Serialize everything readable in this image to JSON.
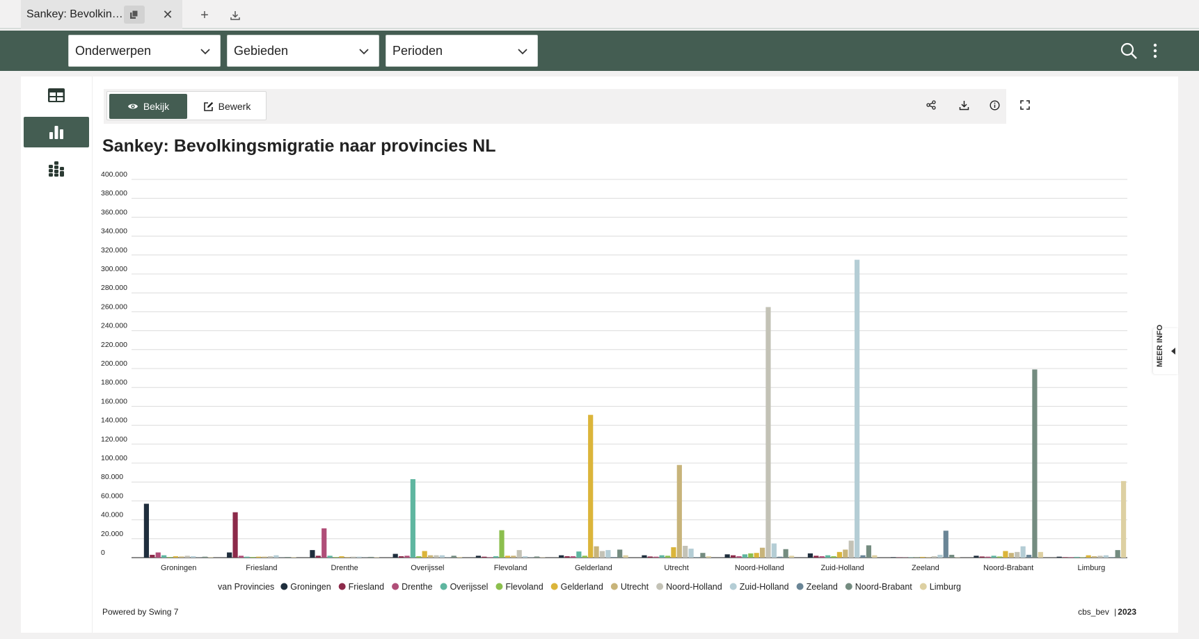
{
  "tab": {
    "title": "Sankey: Bevolkingsmigratie naar provincies NL",
    "close": "✕",
    "new": "+"
  },
  "filters": [
    {
      "label": "Onderwerpen"
    },
    {
      "label": "Gebieden"
    },
    {
      "label": "Perioden"
    }
  ],
  "view": {
    "bekijk": "Bekijk",
    "bewerk": "Bewerk"
  },
  "meer_info": "MEER INFO",
  "footer": {
    "powered": "Powered by Swing 7",
    "source": "cbs_bev",
    "year": "2023"
  },
  "chart_data": {
    "type": "bar",
    "title": "Sankey: Bevolkingsmigratie naar provincies NL",
    "xlabel": "",
    "ylabel": "",
    "ylim": [
      0,
      400000
    ],
    "yticks": [
      0,
      20000,
      40000,
      60000,
      80000,
      100000,
      120000,
      140000,
      160000,
      180000,
      200000,
      220000,
      240000,
      260000,
      280000,
      300000,
      320000,
      340000,
      360000,
      380000,
      400000
    ],
    "ytick_labels": [
      "0",
      "20.000",
      "40.000",
      "60.000",
      "80.000",
      "100.000",
      "120.000",
      "140.000",
      "160.000",
      "180.000",
      "200.000",
      "220.000",
      "240.000",
      "260.000",
      "280.000",
      "300.000",
      "320.000",
      "340.000",
      "360.000",
      "380.000",
      "400.000"
    ],
    "grid": true,
    "legend_title": "van Provincies",
    "legend_position": "bottom",
    "categories": [
      "Groningen",
      "Friesland",
      "Drenthe",
      "Overijssel",
      "Flevoland",
      "Gelderland",
      "Utrecht",
      "Noord-Holland",
      "Zuid-Holland",
      "Zeeland",
      "Noord-Brabant",
      "Limburg"
    ],
    "series": [
      {
        "name": "Groningen",
        "color": "#1f2e3d",
        "values": [
          57000,
          5500,
          8000,
          4000,
          2000,
          2500,
          2500,
          3500,
          4500,
          500,
          2000,
          1000
        ]
      },
      {
        "name": "Friesland",
        "color": "#8c2a4a",
        "values": [
          3000,
          48000,
          2000,
          1500,
          1000,
          1500,
          1200,
          2500,
          2000,
          300,
          1200,
          500
        ]
      },
      {
        "name": "Drenthe",
        "color": "#b04e78",
        "values": [
          5500,
          2000,
          31000,
          2000,
          500,
          1500,
          1000,
          1500,
          1500,
          200,
          1000,
          500
        ]
      },
      {
        "name": "Overijssel",
        "color": "#5fb6a0",
        "values": [
          2500,
          1000,
          2000,
          83000,
          1500,
          6500,
          2500,
          3500,
          2500,
          300,
          2000,
          800
        ]
      },
      {
        "name": "Flevoland",
        "color": "#8cbf4e",
        "values": [
          700,
          700,
          600,
          1500,
          29000,
          2000,
          2000,
          4500,
          1500,
          200,
          1200,
          400
        ]
      },
      {
        "name": "Gelderland",
        "color": "#dbb53a",
        "values": [
          1500,
          1000,
          1500,
          7000,
          2000,
          151000,
          11000,
          5000,
          6000,
          800,
          7000,
          2500
        ]
      },
      {
        "name": "Utrecht",
        "color": "#c8b47a",
        "values": [
          1200,
          1000,
          700,
          2500,
          2000,
          12000,
          98000,
          10500,
          8500,
          500,
          5000,
          1500
        ]
      },
      {
        "name": "Noord-Holland",
        "color": "#c3c2b6",
        "values": [
          2000,
          1500,
          1000,
          2500,
          8000,
          7000,
          12500,
          265000,
          18000,
          1500,
          6000,
          2000
        ]
      },
      {
        "name": "Zuid-Holland",
        "color": "#b4cdd5",
        "values": [
          1500,
          2500,
          1000,
          2500,
          1500,
          8000,
          9500,
          15000,
          315000,
          3000,
          12000,
          2500
        ]
      },
      {
        "name": "Zeeland",
        "color": "#6a8596",
        "values": [
          200,
          200,
          200,
          300,
          300,
          600,
          500,
          1000,
          2500,
          28500,
          3000,
          500
        ]
      },
      {
        "name": "Noord-Brabant",
        "color": "#748c80",
        "values": [
          1000,
          700,
          800,
          2000,
          1200,
          8500,
          5000,
          9000,
          13000,
          3000,
          199000,
          8000
        ]
      },
      {
        "name": "Limburg",
        "color": "#ddd0a2",
        "values": [
          500,
          500,
          400,
          800,
          300,
          2500,
          1500,
          2000,
          2500,
          300,
          6000,
          81000
        ]
      }
    ]
  }
}
